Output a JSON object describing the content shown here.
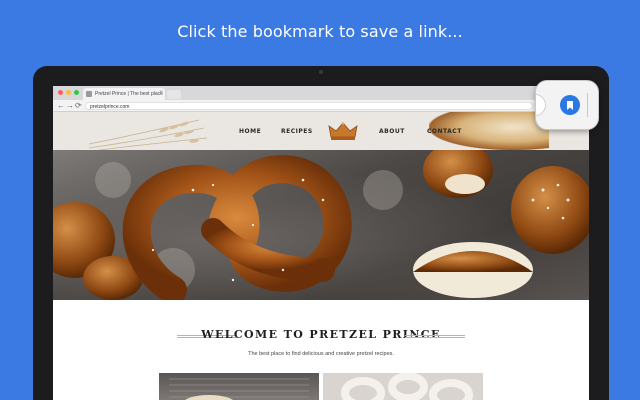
{
  "promo": {
    "caption": "Click the bookmark to save a link..."
  },
  "browser": {
    "tab_title": "Pretzel Prince | The best place",
    "tab_close": "×",
    "url": "pretzelprince.com",
    "nav": {
      "back": "←",
      "forward": "→",
      "reload": "⟳"
    }
  },
  "site": {
    "nav_links": [
      "HOME",
      "RECIPES",
      "ABOUT",
      "CONTACT"
    ],
    "heading": "WELCOME TO PRETZEL PRINCE",
    "tagline": "The best place to find delicious and creative pretzel recipes."
  },
  "icons": {
    "bookmark": "bookmark-icon",
    "crown": "crown-logo",
    "wheat": "wheat-decoration"
  },
  "colors": {
    "background": "#3b7ae2",
    "bookmark_button": "#2b78e4",
    "heading_rule": "#e0a873"
  }
}
